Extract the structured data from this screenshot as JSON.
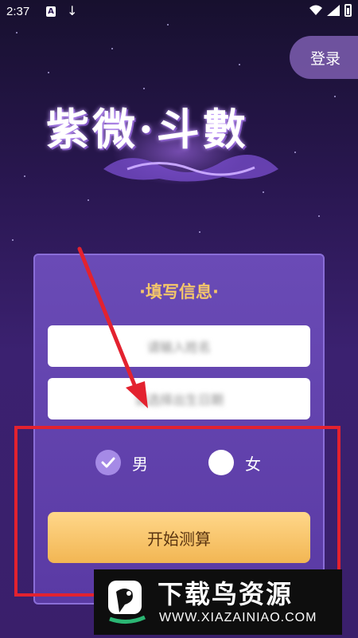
{
  "status_bar": {
    "time": "2:37",
    "icon_a_label": "A",
    "download_icon": "↓"
  },
  "login_label": "登录",
  "logo_text": "紫微·斗數",
  "form": {
    "title": "·填写信息·",
    "name_value": "请输入姓名",
    "birth_value": "请选择出生日期",
    "gender_male": "男",
    "gender_female": "女",
    "selected_gender": "男",
    "start_label": "开始测算"
  },
  "watermark": {
    "title": "下载鸟资源",
    "url": "WWW.XIAZAINIAO.COM"
  },
  "colors": {
    "accent_title": "#f4c66a",
    "button_gradient_top": "#ffd78a",
    "button_gradient_bottom": "#f2b653",
    "annotation_red": "#e3222f"
  }
}
